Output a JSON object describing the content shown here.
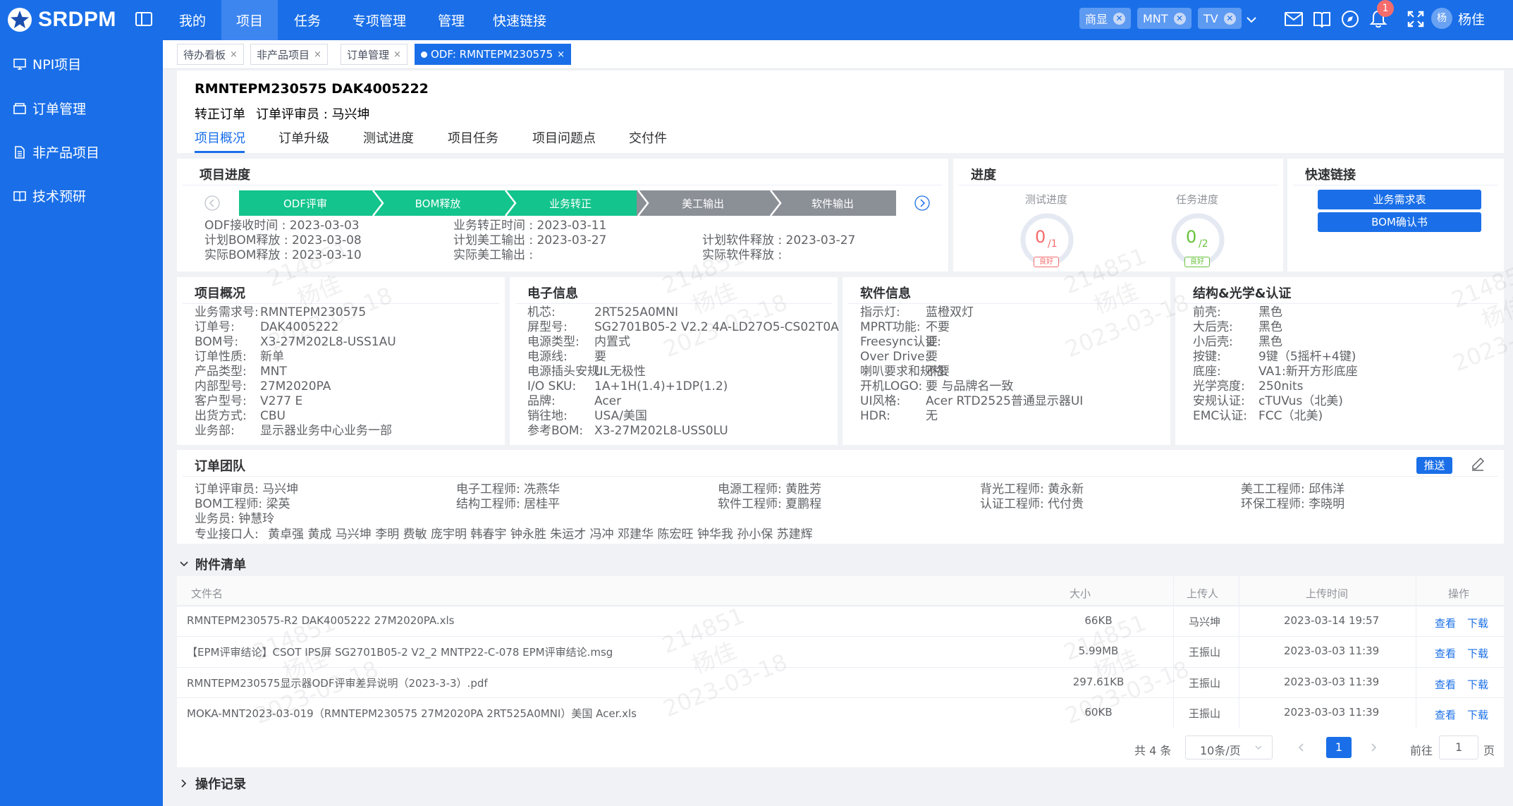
{
  "app": {
    "name": "SRDPM",
    "brand_color": "#1a6fe8"
  },
  "nav": {
    "items": [
      "我的",
      "项目",
      "任务",
      "专项管理",
      "管理",
      "快速链接"
    ],
    "active": "项目"
  },
  "top_chips": [
    "商显",
    "MNT",
    "TV"
  ],
  "notifications": {
    "count": "1"
  },
  "user": {
    "avatar_text": "杨",
    "name": "杨佳"
  },
  "sidebar": {
    "items": [
      "NPI项目",
      "订单管理",
      "非产品项目",
      "技术预研"
    ]
  },
  "open_tabs": [
    "待办看板",
    "非产品项目",
    "订单管理",
    "ODF: RMNTEPM230575"
  ],
  "header": {
    "title": "RMNTEPM230575 DAK4005222",
    "subtitle": {
      "type": "转正订单",
      "reviewer_label": "订单评审员 : 马兴坤"
    },
    "tabs": [
      "项目概况",
      "订单升级",
      "测试进度",
      "项目任务",
      "项目问题点",
      "交付件"
    ],
    "active_tab": "项目概况"
  },
  "project_progress": {
    "title": "项目进度",
    "stages": [
      {
        "name": "ODF评审",
        "done": true
      },
      {
        "name": "BOM释放",
        "done": true
      },
      {
        "name": "业务转正",
        "done": true
      },
      {
        "name": "美工输出",
        "done": false
      },
      {
        "name": "软件输出",
        "done": false
      }
    ],
    "dates": [
      [
        "ODF接收时间 : 2023-03-03",
        "计划BOM释放 : 2023-03-08",
        "实际BOM释放 : 2023-03-10"
      ],
      [
        "业务转正时间 : 2023-03-11",
        "计划美工输出 : 2023-03-27",
        "实际美工输出 :"
      ],
      [
        "",
        "计划软件释放 : 2023-03-27",
        "实际软件释放 :"
      ]
    ]
  },
  "progress": {
    "title": "进度",
    "gauges": [
      {
        "label": "测试进度",
        "done": "0",
        "total": "/1",
        "status": "良好"
      },
      {
        "label": "任务进度",
        "done": "0",
        "total": "/2",
        "status": "良好"
      }
    ],
    "colors": {
      "gauge_text": "#f56c6c",
      "good_text": "#67c23a",
      "bad_tag": "#f56c6c"
    }
  },
  "quick_links": {
    "title": "快速链接",
    "buttons": [
      "业务需求表",
      "BOM确认书"
    ]
  },
  "overview": {
    "title": "项目概况",
    "rows": [
      {
        "k": "业务需求号:",
        "v": "RMNTEPM230575"
      },
      {
        "k": "订单号:",
        "v": "DAK4005222"
      },
      {
        "k": "BOM号:",
        "v": "X3-27M202L8-USS1AU"
      },
      {
        "k": "订单性质:",
        "v": "新单"
      },
      {
        "k": "产品类型:",
        "v": "MNT"
      },
      {
        "k": "内部型号:",
        "v": "27M2020PA"
      },
      {
        "k": "客户型号:",
        "v": "V277 E"
      },
      {
        "k": "出货方式:",
        "v": "CBU"
      },
      {
        "k": "业务部:",
        "v": "显示器业务中心业务一部"
      }
    ]
  },
  "electronics": {
    "title": "电子信息",
    "rows": [
      {
        "k": "机芯:",
        "v": "2RT525A0MNI"
      },
      {
        "k": "屏型号:",
        "v": "SG2701B05-2 V2.2 4A-LD27O5-CS02T0A"
      },
      {
        "k": "电源类型:",
        "v": "内置式"
      },
      {
        "k": "电源线:",
        "v": "要"
      },
      {
        "k": "电源插头安规:",
        "v": "UL无极性"
      },
      {
        "k": "I/O SKU:",
        "v": "1A+1H(1.4)+1DP(1.2)"
      },
      {
        "k": "品牌:",
        "v": "Acer"
      },
      {
        "k": "销往地:",
        "v": "USA/美国"
      },
      {
        "k": "参考BOM:",
        "v": "X3-27M202L8-USS0LU"
      }
    ]
  },
  "software": {
    "title": "软件信息",
    "rows": [
      {
        "k": "指示灯:",
        "v": "蓝橙双灯"
      },
      {
        "k": "MPRT功能:",
        "v": "不要"
      },
      {
        "k": "Freesync认证:",
        "v": "要"
      },
      {
        "k": "Over Drive:",
        "v": "要"
      },
      {
        "k": "喇叭要求和规格:",
        "v": "不要"
      },
      {
        "k": "开机LOGO:",
        "v": "要 与品牌名一致"
      },
      {
        "k": "UI风格:",
        "v": "Acer RTD2525普通显示器UI"
      },
      {
        "k": "HDR:",
        "v": "无"
      }
    ]
  },
  "structure": {
    "title": "结构&光学&认证",
    "rows": [
      {
        "k": "前壳:",
        "v": "黑色"
      },
      {
        "k": "大后壳:",
        "v": "黑色"
      },
      {
        "k": "小后壳:",
        "v": "黑色"
      },
      {
        "k": "按键:",
        "v": "9键（5摇杆+4键)"
      },
      {
        "k": "底座:",
        "v": "VA1:新开方形底座"
      },
      {
        "k": "光学亮度:",
        "v": "250nits"
      },
      {
        "k": "安规认证:",
        "v": "cTUVus（北美)"
      },
      {
        "k": "EMC认证:",
        "v": "FCC（北美)"
      }
    ]
  },
  "team": {
    "title": "订单团队",
    "push_label": "推送",
    "members": [
      {
        "k": "订单评审员:",
        "v": "马兴坤"
      },
      {
        "k": "电子工程师:",
        "v": "冼燕华"
      },
      {
        "k": "电源工程师:",
        "v": "黄胜芳"
      },
      {
        "k": "背光工程师:",
        "v": "黄永新"
      },
      {
        "k": "美工工程师:",
        "v": "邱伟洋"
      },
      {
        "k": "BOM工程师:",
        "v": "梁英"
      },
      {
        "k": "结构工程师:",
        "v": "居桂平"
      },
      {
        "k": "软件工程师:",
        "v": "夏鹏程"
      },
      {
        "k": "认证工程师:",
        "v": "代付贵"
      },
      {
        "k": "环保工程师:",
        "v": "李晓明"
      },
      {
        "k": "业务员:",
        "v": "钟慧玲"
      }
    ],
    "contacts_label": "专业接口人:",
    "contacts": "黄卓强 黄成 马兴坤 李明 费敏 庞宇明 韩春宇 钟永胜 朱运才 冯冲 邓建华 陈宏旺 钟华我 孙小保 苏建辉"
  },
  "attachments": {
    "title": "附件清单",
    "columns": [
      "文件名",
      "大小",
      "上传人",
      "上传时间",
      "操作"
    ],
    "rows": [
      {
        "name": "RMNTEPM230575-R2 DAK4005222 27M2020PA.xls",
        "size": "66KB",
        "uploader": "马兴坤",
        "time": "2023-03-14 19:57"
      },
      {
        "name": "【EPM评审结论】CSOT IPS屏 SG2701B05-2 V2_2 MNTP22-C-078 EPM评审结论.msg",
        "size": "5.99MB",
        "uploader": "王振山",
        "time": "2023-03-03 11:39"
      },
      {
        "name": "RMNTEPM230575显示器ODF评审差异说明（2023-3-3）.pdf",
        "size": "297.61KB",
        "uploader": "王振山",
        "time": "2023-03-03 11:39"
      },
      {
        "name": "MOKA-MNT2023-03-019（RMNTEPM230575 27M2020PA 2RT525A0MNI）美国 Acer.xls",
        "size": "60KB",
        "uploader": "王振山",
        "time": "2023-03-03 11:39"
      }
    ],
    "actions": {
      "view": "查看",
      "download": "下载"
    },
    "pagination": {
      "total": "共 4 条",
      "page_size": "10条/页",
      "current": "1",
      "goto_label": "前往",
      "goto_value": "1",
      "page_suffix": "页"
    }
  },
  "operation_log": {
    "title": "操作记录"
  },
  "watermark": [
    "214851",
    "杨佳",
    "2023-03-18"
  ]
}
